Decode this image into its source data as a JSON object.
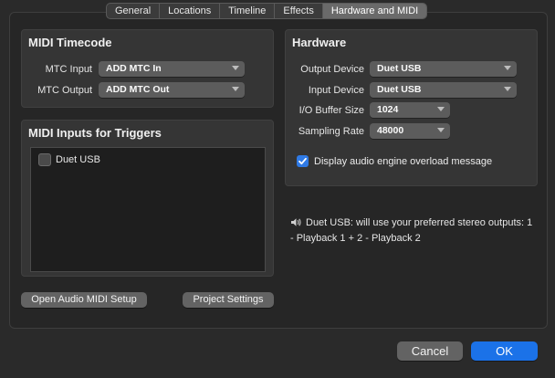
{
  "tabs": [
    "General",
    "Locations",
    "Timeline",
    "Effects",
    "Hardware and MIDI"
  ],
  "midi_timecode": {
    "title": "MIDI Timecode",
    "mtc_input_label": "MTC Input",
    "mtc_input_value": "ADD MTC In",
    "mtc_output_label": "MTC Output",
    "mtc_output_value": "ADD MTC Out"
  },
  "midi_triggers": {
    "title": "MIDI Inputs for Triggers",
    "items": [
      {
        "label": "Duet USB",
        "checked": false
      }
    ]
  },
  "hardware": {
    "title": "Hardware",
    "output_device_label": "Output Device",
    "output_device_value": "Duet USB",
    "input_device_label": "Input Device",
    "input_device_value": "Duet USB",
    "buffer_label": "I/O Buffer Size",
    "buffer_value": "1024",
    "sampling_label": "Sampling Rate",
    "sampling_value": "48000",
    "overload_label": "Display audio engine overload message",
    "overload_checked": true
  },
  "info_text": "Duet USB: will use your preferred stereo outputs: 1 - Playback 1 + 2 - Playback 2",
  "buttons": {
    "audio_midi_setup": "Open Audio MIDI Setup",
    "project_settings": "Project Settings",
    "cancel": "Cancel",
    "ok": "OK"
  },
  "colors": {
    "accent": "#1b72e8",
    "panel": "#353535"
  }
}
